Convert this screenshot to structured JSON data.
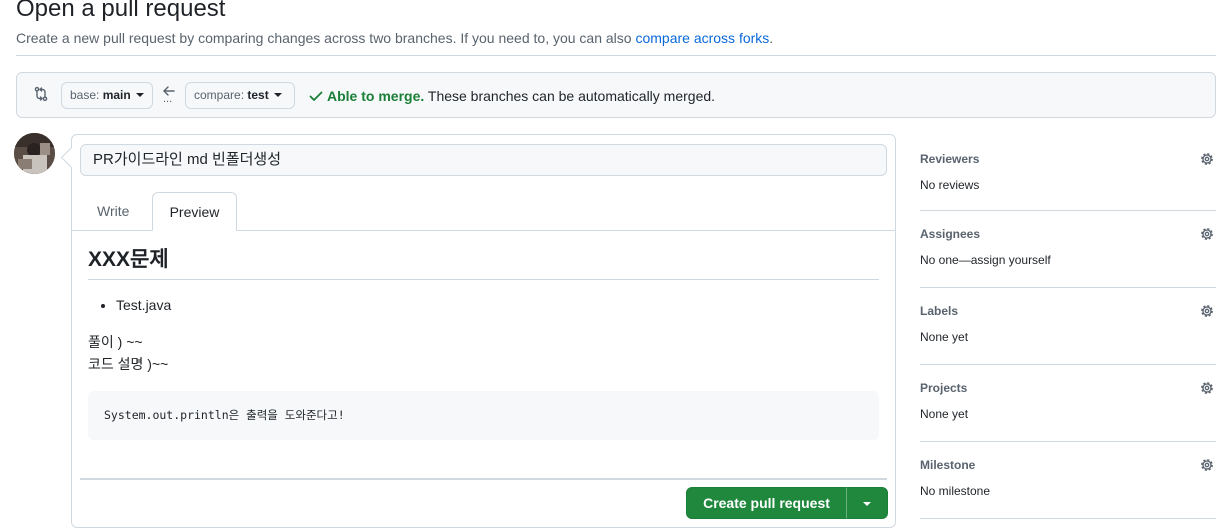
{
  "header": {
    "title": "Open a pull request",
    "subtitle": "Create a new pull request by comparing changes across two branches. If you need to, you can also ",
    "compare_forks_link": "compare across forks",
    "subtitle_end": "."
  },
  "range": {
    "base_label": "base:",
    "base_value": "main",
    "ellipsis": "...",
    "compare_label": "compare:",
    "compare_value": "test",
    "merge_ok": "Able to merge.",
    "merge_text": " These branches can be automatically merged."
  },
  "composer": {
    "title_value": "PR가이드라인 md 빈폴더생성",
    "tabs": [
      {
        "label": "Write",
        "selected": false
      },
      {
        "label": "Preview",
        "selected": true
      }
    ],
    "preview": {
      "heading": "XXX문제",
      "list_items": [
        "Test.java"
      ],
      "lines": [
        "풀이 ) ~~",
        "코드 설명 )~~"
      ],
      "code": "System.out.println은 출력을 도와준다고!"
    },
    "submit_label": "Create pull request"
  },
  "sidebar": {
    "sections": [
      {
        "heading": "Reviewers",
        "value": "No reviews"
      },
      {
        "heading": "Assignees",
        "value": "No one—assign yourself"
      },
      {
        "heading": "Labels",
        "value": "None yet"
      },
      {
        "heading": "Projects",
        "value": "None yet"
      },
      {
        "heading": "Milestone",
        "value": "No milestone"
      }
    ]
  },
  "colors": {
    "accent_link": "#0969da",
    "success": "#1a7f37",
    "primary_button": "#1f883d",
    "border": "#d1d9e0"
  },
  "icons": [
    "git-compare-icon",
    "arrow-left-icon",
    "check-icon",
    "gear-icon",
    "avatar"
  ]
}
